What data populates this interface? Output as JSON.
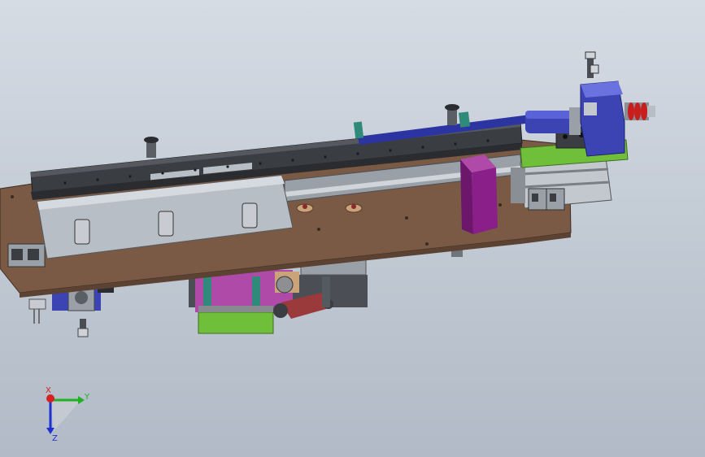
{
  "viewport": {
    "background_top": "#d6dce4",
    "background_bottom": "#b1bac6"
  },
  "model": {
    "colors": {
      "base_plate": "#7a5a44",
      "rail_dark": "#3a3d42",
      "rail_mid": "#55595f",
      "cover_silver": "#b8bec6",
      "motor_blue": "#3c44b4",
      "purple_block": "#8a1f8a",
      "green_plate": "#6fbf3a",
      "red_spring": "#c81e1e",
      "red_arm": "#9a3a3a",
      "magenta_block": "#b04aa8",
      "teal": "#2f8a7a"
    }
  },
  "triad": {
    "x_label": "X",
    "y_label": "Y",
    "z_label": "Z",
    "x_color": "#d82020",
    "y_color": "#20b020",
    "z_color": "#2030d0"
  }
}
